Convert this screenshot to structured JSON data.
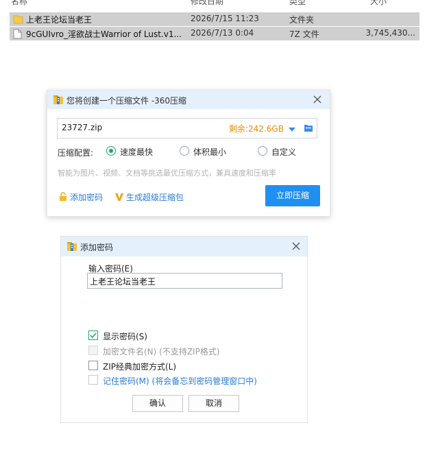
{
  "file_list": {
    "headers": [
      "名称",
      "修改日期",
      "类型",
      "大小"
    ],
    "rows": [
      {
        "name": "上老王论坛当老王",
        "date": "2026/7/15 11:23",
        "type": "文件夹",
        "size": "",
        "icon": "folder-icon"
      },
      {
        "name": "9cGUIvro_淫欲战士Warrior of Lust.v1...",
        "date": "2026/7/13 0:04",
        "type": "7Z 文件",
        "size": "3,745,430...",
        "icon": "file-icon"
      }
    ]
  },
  "compress_dialog": {
    "title": "您将创建一个压缩文件 -360压缩",
    "path": "23727.zip",
    "free_space": "剩余:242.6GB",
    "config_label": "压缩配置:",
    "options": [
      {
        "label": "速度最快",
        "selected": true
      },
      {
        "label": "体积最小",
        "selected": false
      },
      {
        "label": "自定义",
        "selected": false
      }
    ],
    "hint": "智能为图片、视频、文档等挑选最优压缩方式，兼具速度和压缩率",
    "add_password_link": "添加密码",
    "super_package_link": "生成超级压缩包",
    "compress_button": "立即压缩",
    "accent_color": "#1f8ff0"
  },
  "password_dialog": {
    "title": "添加密码",
    "input_label": "输入密码(E)",
    "password_value": "上老王论坛当老王",
    "checkboxes": [
      {
        "label": "显示密码(S)",
        "checked": true,
        "enabled": true
      },
      {
        "label": "加密文件名(N) (不支持ZIP格式)",
        "checked": false,
        "enabled": false
      },
      {
        "label": "ZIP经典加密方式(L)",
        "checked": false,
        "enabled": true
      },
      {
        "label": "记住密码(M) (将会备忘到密码管理窗口中)",
        "checked": false,
        "enabled": true
      }
    ],
    "ok_button": "确认",
    "cancel_button": "取消"
  }
}
